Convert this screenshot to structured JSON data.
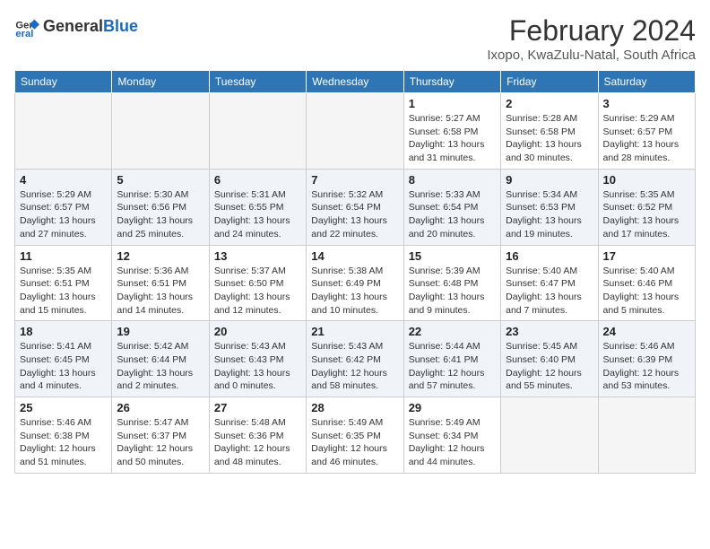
{
  "logo": {
    "general": "General",
    "blue": "Blue"
  },
  "header": {
    "title": "February 2024",
    "subtitle": "Ixopo, KwaZulu-Natal, South Africa"
  },
  "days_of_week": [
    "Sunday",
    "Monday",
    "Tuesday",
    "Wednesday",
    "Thursday",
    "Friday",
    "Saturday"
  ],
  "weeks": [
    [
      {
        "num": "",
        "info": "",
        "empty": true
      },
      {
        "num": "",
        "info": "",
        "empty": true
      },
      {
        "num": "",
        "info": "",
        "empty": true
      },
      {
        "num": "",
        "info": "",
        "empty": true
      },
      {
        "num": "1",
        "info": "Sunrise: 5:27 AM\nSunset: 6:58 PM\nDaylight: 13 hours\nand 31 minutes."
      },
      {
        "num": "2",
        "info": "Sunrise: 5:28 AM\nSunset: 6:58 PM\nDaylight: 13 hours\nand 30 minutes."
      },
      {
        "num": "3",
        "info": "Sunrise: 5:29 AM\nSunset: 6:57 PM\nDaylight: 13 hours\nand 28 minutes."
      }
    ],
    [
      {
        "num": "4",
        "info": "Sunrise: 5:29 AM\nSunset: 6:57 PM\nDaylight: 13 hours\nand 27 minutes."
      },
      {
        "num": "5",
        "info": "Sunrise: 5:30 AM\nSunset: 6:56 PM\nDaylight: 13 hours\nand 25 minutes."
      },
      {
        "num": "6",
        "info": "Sunrise: 5:31 AM\nSunset: 6:55 PM\nDaylight: 13 hours\nand 24 minutes."
      },
      {
        "num": "7",
        "info": "Sunrise: 5:32 AM\nSunset: 6:54 PM\nDaylight: 13 hours\nand 22 minutes."
      },
      {
        "num": "8",
        "info": "Sunrise: 5:33 AM\nSunset: 6:54 PM\nDaylight: 13 hours\nand 20 minutes."
      },
      {
        "num": "9",
        "info": "Sunrise: 5:34 AM\nSunset: 6:53 PM\nDaylight: 13 hours\nand 19 minutes."
      },
      {
        "num": "10",
        "info": "Sunrise: 5:35 AM\nSunset: 6:52 PM\nDaylight: 13 hours\nand 17 minutes."
      }
    ],
    [
      {
        "num": "11",
        "info": "Sunrise: 5:35 AM\nSunset: 6:51 PM\nDaylight: 13 hours\nand 15 minutes."
      },
      {
        "num": "12",
        "info": "Sunrise: 5:36 AM\nSunset: 6:51 PM\nDaylight: 13 hours\nand 14 minutes."
      },
      {
        "num": "13",
        "info": "Sunrise: 5:37 AM\nSunset: 6:50 PM\nDaylight: 13 hours\nand 12 minutes."
      },
      {
        "num": "14",
        "info": "Sunrise: 5:38 AM\nSunset: 6:49 PM\nDaylight: 13 hours\nand 10 minutes."
      },
      {
        "num": "15",
        "info": "Sunrise: 5:39 AM\nSunset: 6:48 PM\nDaylight: 13 hours\nand 9 minutes."
      },
      {
        "num": "16",
        "info": "Sunrise: 5:40 AM\nSunset: 6:47 PM\nDaylight: 13 hours\nand 7 minutes."
      },
      {
        "num": "17",
        "info": "Sunrise: 5:40 AM\nSunset: 6:46 PM\nDaylight: 13 hours\nand 5 minutes."
      }
    ],
    [
      {
        "num": "18",
        "info": "Sunrise: 5:41 AM\nSunset: 6:45 PM\nDaylight: 13 hours\nand 4 minutes."
      },
      {
        "num": "19",
        "info": "Sunrise: 5:42 AM\nSunset: 6:44 PM\nDaylight: 13 hours\nand 2 minutes."
      },
      {
        "num": "20",
        "info": "Sunrise: 5:43 AM\nSunset: 6:43 PM\nDaylight: 13 hours\nand 0 minutes."
      },
      {
        "num": "21",
        "info": "Sunrise: 5:43 AM\nSunset: 6:42 PM\nDaylight: 12 hours\nand 58 minutes."
      },
      {
        "num": "22",
        "info": "Sunrise: 5:44 AM\nSunset: 6:41 PM\nDaylight: 12 hours\nand 57 minutes."
      },
      {
        "num": "23",
        "info": "Sunrise: 5:45 AM\nSunset: 6:40 PM\nDaylight: 12 hours\nand 55 minutes."
      },
      {
        "num": "24",
        "info": "Sunrise: 5:46 AM\nSunset: 6:39 PM\nDaylight: 12 hours\nand 53 minutes."
      }
    ],
    [
      {
        "num": "25",
        "info": "Sunrise: 5:46 AM\nSunset: 6:38 PM\nDaylight: 12 hours\nand 51 minutes."
      },
      {
        "num": "26",
        "info": "Sunrise: 5:47 AM\nSunset: 6:37 PM\nDaylight: 12 hours\nand 50 minutes."
      },
      {
        "num": "27",
        "info": "Sunrise: 5:48 AM\nSunset: 6:36 PM\nDaylight: 12 hours\nand 48 minutes."
      },
      {
        "num": "28",
        "info": "Sunrise: 5:49 AM\nSunset: 6:35 PM\nDaylight: 12 hours\nand 46 minutes."
      },
      {
        "num": "29",
        "info": "Sunrise: 5:49 AM\nSunset: 6:34 PM\nDaylight: 12 hours\nand 44 minutes."
      },
      {
        "num": "",
        "info": "",
        "empty": true
      },
      {
        "num": "",
        "info": "",
        "empty": true
      }
    ]
  ]
}
